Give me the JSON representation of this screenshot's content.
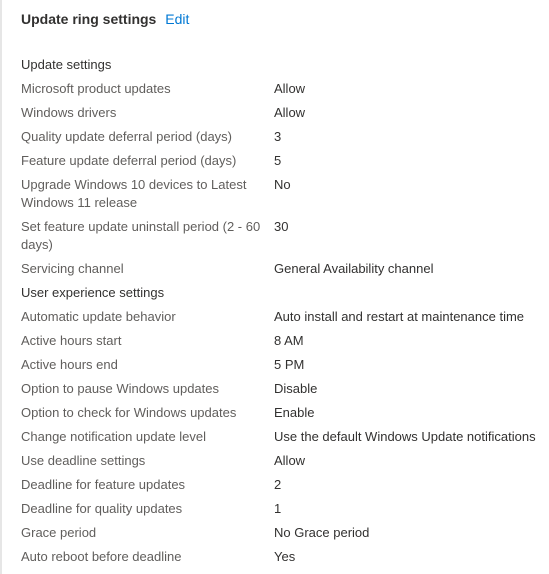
{
  "header": {
    "title": "Update ring settings",
    "edit_label": "Edit"
  },
  "sections": [
    {
      "title": "Update settings",
      "rows": [
        {
          "label": "Microsoft product updates",
          "value": "Allow"
        },
        {
          "label": "Windows drivers",
          "value": "Allow"
        },
        {
          "label": "Quality update deferral period (days)",
          "value": "3"
        },
        {
          "label": "Feature update deferral period (days)",
          "value": "5"
        },
        {
          "label": "Upgrade Windows 10 devices to Latest Windows 11 release",
          "value": "No"
        },
        {
          "label": "Set feature update uninstall period (2 - 60 days)",
          "value": "30"
        },
        {
          "label": "Servicing channel",
          "value": "General Availability channel"
        }
      ]
    },
    {
      "title": "User experience settings",
      "rows": [
        {
          "label": "Automatic update behavior",
          "value": "Auto install and restart at maintenance time"
        },
        {
          "label": "Active hours start",
          "value": "8 AM"
        },
        {
          "label": "Active hours end",
          "value": "5 PM"
        },
        {
          "label": "Option to pause Windows updates",
          "value": "Disable"
        },
        {
          "label": "Option to check for Windows updates",
          "value": "Enable"
        },
        {
          "label": "Change notification update level",
          "value": "Use the default Windows Update notifications"
        },
        {
          "label": "Use deadline settings",
          "value": "Allow"
        },
        {
          "label": "Deadline for feature updates",
          "value": "2"
        },
        {
          "label": "Deadline for quality updates",
          "value": "1"
        },
        {
          "label": "Grace period",
          "value": "No Grace period"
        },
        {
          "label": "Auto reboot before deadline",
          "value": "Yes"
        }
      ]
    }
  ]
}
